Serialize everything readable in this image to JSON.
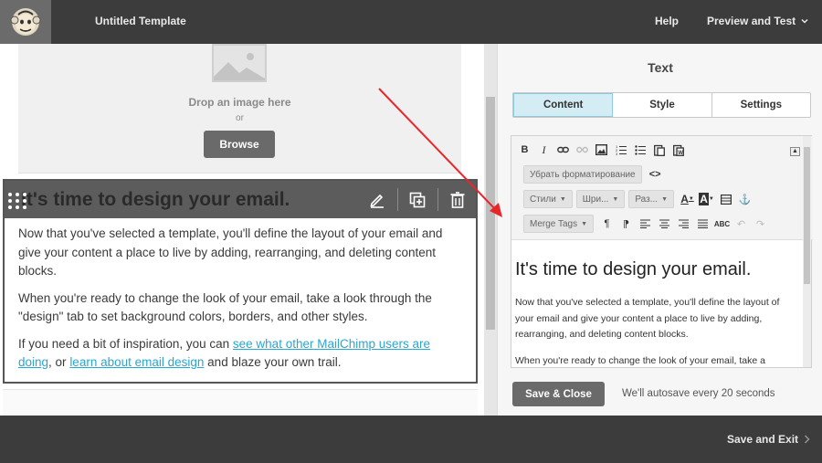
{
  "header": {
    "title": "Untitled Template",
    "help": "Help",
    "preview": "Preview and Test"
  },
  "canvas": {
    "drop_text": "Drop an image here",
    "or_text": "or",
    "browse_label": "Browse",
    "block_heading": "It's time to design your email.",
    "body": {
      "p1": "Now that you've selected a template, you'll define the layout of your email and give your content a place to live by adding, rearranging, and deleting content blocks.",
      "p2": "When you're ready to change the look of your email, take a look through the \"design\" tab to set background colors, borders, and other styles.",
      "p3_before": "If you need a bit of inspiration, you can ",
      "p3_link1": "see what other MailChimp users are doing",
      "p3_middle": ", or ",
      "p3_link2": "learn about email design",
      "p3_after": " and blaze your own trail."
    }
  },
  "panel": {
    "title": "Text",
    "tabs": [
      {
        "label": "Content",
        "active": true
      },
      {
        "label": "Style",
        "active": false
      },
      {
        "label": "Settings",
        "active": false
      }
    ],
    "toolbar": {
      "remove_format": "Убрать форматирование",
      "styles": "Стили",
      "font": "Шри...",
      "size": "Раз...",
      "merge_tags": "Merge Tags"
    },
    "editor_heading": "It's time to design your email.",
    "editor_p1": "Now that you've selected a template, you'll define the layout of your email and give your content a place to live by adding, rearranging, and deleting content blocks.",
    "editor_p2": "When you're ready to change the look of your email, take a",
    "save_close": "Save & Close",
    "autosave": "We'll autosave every 20 seconds"
  },
  "footer": {
    "save_exit": "Save and Exit"
  },
  "colors": {
    "topbar": "#3c3c3c",
    "active_tab": "#d4ecf4",
    "link": "#2aa6cf",
    "annotation_arrow": "#e8262a"
  }
}
